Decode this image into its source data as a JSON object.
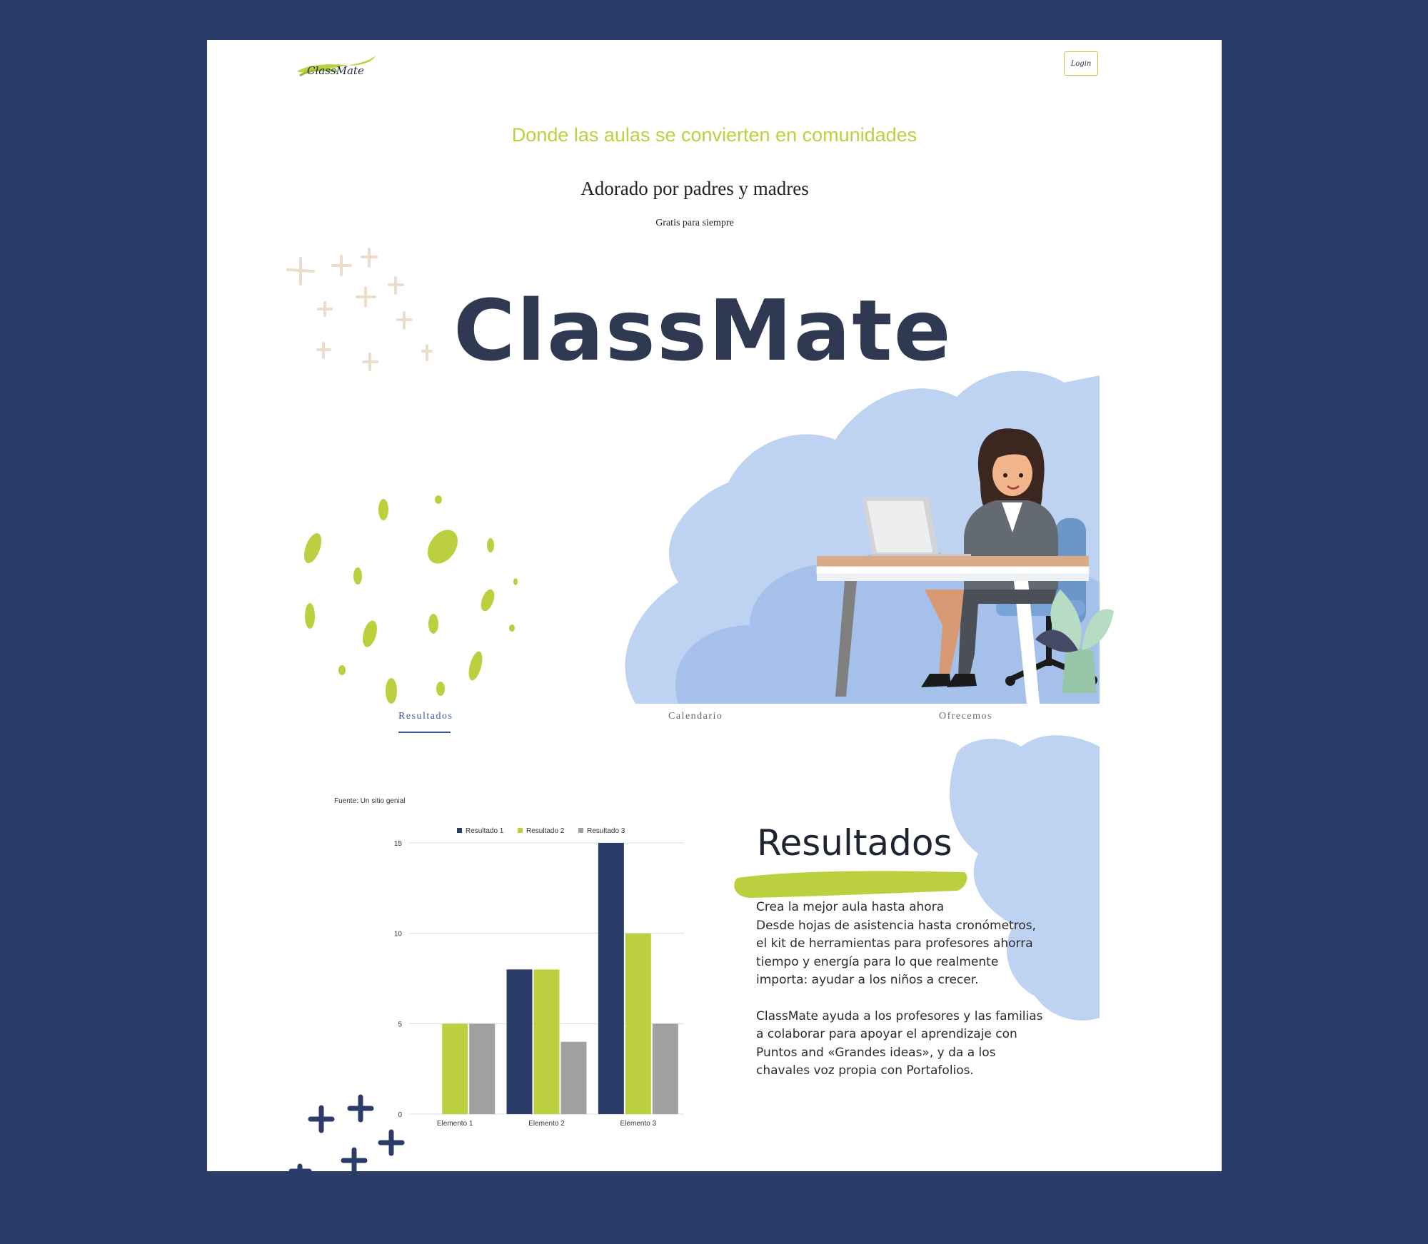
{
  "header": {
    "logo_text": "ClassMate",
    "login_label": "Login"
  },
  "hero": {
    "headline": "Donde las aulas se convierten en comunidades",
    "subheadline": "Adorado por padres y madres",
    "tagline": "Gratis para siempre",
    "brand_title": "ClassMate"
  },
  "tabs": [
    {
      "label": "Resultados",
      "active": true
    },
    {
      "label": "Calendario",
      "active": false
    },
    {
      "label": "Ofrecemos",
      "active": false
    }
  ],
  "results": {
    "source": "Fuente: Un sitio genial",
    "title": "Resultados",
    "paragraphs": [
      "Crea la mejor aula hasta ahora",
      "Desde hojas de asistencia hasta cronómetros, el kit de herramientas para profesores ahorra tiempo y energía para lo que realmente importa: ayudar a los niños a crecer.",
      "ClassMate ayuda a los profesores y las familias a colaborar para apoyar el aprendizaje  con Puntos and «Grandes ideas», y da a los chavales voz propia con Portafolios."
    ]
  },
  "colors": {
    "background": "#2b3c69",
    "accent_green": "#bcd03f",
    "navy": "#2b3c69",
    "grey": "#a0a0a0",
    "tab_active": "#3e57b6"
  },
  "chart_data": {
    "type": "bar",
    "categories": [
      "Elemento 1",
      "Elemento 2",
      "Elemento 3"
    ],
    "series": [
      {
        "name": "Resultado 1",
        "color": "#2b3c69",
        "values": [
          0,
          8,
          15
        ]
      },
      {
        "name": "Resultado 2",
        "color": "#bcd03f",
        "values": [
          5,
          8,
          10
        ]
      },
      {
        "name": "Resultado 3",
        "color": "#a0a0a0",
        "values": [
          5,
          4,
          5
        ]
      }
    ],
    "ylim": [
      0,
      15
    ],
    "yticks": [
      "0",
      "5",
      "10",
      "15"
    ],
    "grid": true,
    "legend": "top"
  }
}
